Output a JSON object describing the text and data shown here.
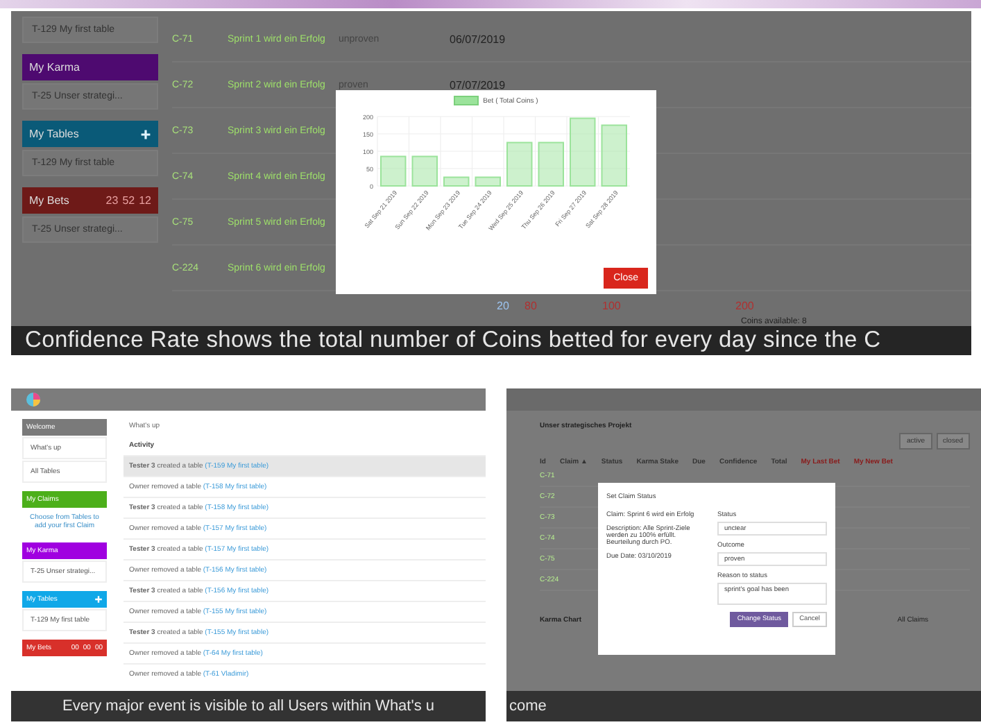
{
  "top_panel": {
    "sidebar": [
      {
        "kind": "item",
        "text": "T-129 My first table"
      },
      {
        "kind": "header",
        "text": "My Karma",
        "color": "#4e0a70"
      },
      {
        "kind": "item",
        "text": "T-25 Unser strategi..."
      },
      {
        "kind": "header-add",
        "text": "My Tables",
        "color": "#0a5a78"
      },
      {
        "kind": "item",
        "text": "T-129 My first table"
      },
      {
        "kind": "header-timer",
        "text": "My Bets",
        "color": "#6e1a18",
        "timer": [
          "23",
          "52",
          "12"
        ]
      },
      {
        "kind": "item",
        "text": "T-25 Unser strategi..."
      }
    ],
    "rows": [
      {
        "id": "C-71",
        "claim": "Sprint 1 wird ein Erfolg",
        "status": "unproven",
        "date": "06/07/2019"
      },
      {
        "id": "C-72",
        "claim": "Sprint 2 wird ein Erfolg",
        "status": "proven",
        "date": "07/07/2019"
      },
      {
        "id": "C-73",
        "claim": "Sprint 3 wird ein Erfolg"
      },
      {
        "id": "C-74",
        "claim": "Sprint 4 wird ein Erfolg"
      },
      {
        "id": "C-75",
        "claim": "Sprint 5 wird ein Erfolg"
      },
      {
        "id": "C-224",
        "claim": "Sprint 6 wird ein Erfolg"
      }
    ],
    "bet_values": [
      {
        "text": "20",
        "color": "#9cc4f0"
      },
      {
        "text": "80",
        "color": "#b03030"
      },
      {
        "text": "100",
        "color": "#b03030"
      },
      {
        "text": "200",
        "color": "#b03030"
      }
    ],
    "coins_available": "Coins available: 8",
    "modal": {
      "close_button": "Close",
      "chart_data": {
        "type": "bar",
        "categories": [
          "Sat Sep 21 2019",
          "Sun Sep 22 2019",
          "Mon Sep 23 2019",
          "Tue Sep 24 2019",
          "Wed Sep 25 2019",
          "Thu Sep 26 2019",
          "Fri Sep 27 2019",
          "Sat Sep 28 2019"
        ],
        "series": [
          {
            "name": "Bet ( Total Coins )",
            "color": "#9be39b",
            "values": [
              85,
              85,
              25,
              25,
              125,
              125,
              195,
              175
            ]
          }
        ],
        "ylim": [
          0,
          200
        ],
        "yticks": [
          0,
          50,
          100,
          150,
          200
        ],
        "grid": true
      }
    },
    "caption": "Confidence Rate shows the total number of Coins betted for every day since the C"
  },
  "bottom_left": {
    "sidebar": [
      {
        "kind": "header",
        "text": "Welcome",
        "color": "#7a7a7a"
      },
      {
        "kind": "item",
        "text": "What's up"
      },
      {
        "kind": "item",
        "text": "All Tables"
      },
      {
        "kind": "header",
        "text": "My Claims",
        "color": "#4caf1a"
      },
      {
        "kind": "note",
        "text": "Choose from Tables to add your first Claim"
      },
      {
        "kind": "header",
        "text": "My Karma",
        "color": "#a000e0"
      },
      {
        "kind": "item",
        "text": "T-25 Unser strategi..."
      },
      {
        "kind": "header-add",
        "text": "My Tables",
        "color": "#10a8e8"
      },
      {
        "kind": "item",
        "text": "T-129 My first table"
      },
      {
        "kind": "header-timer",
        "text": "My Bets",
        "color": "#d8302a",
        "timer": [
          "00",
          "00",
          "00"
        ]
      }
    ],
    "breadcrumb": "What's up",
    "activity_title": "Activity",
    "activity": [
      {
        "text": "**Tester 3** created a table",
        "link": "(T-159 My first table)",
        "selected": true
      },
      {
        "text": "Owner removed a table",
        "link": "(T-158 My first table)",
        "selected": false
      },
      {
        "text": "**Tester 3** created a table",
        "link": "(T-158 My first table)",
        "selected": false
      },
      {
        "text": "Owner removed a table",
        "link": "(T-157 My first table)",
        "selected": false
      },
      {
        "text": "**Tester 3** created a table",
        "link": "(T-157 My first table)",
        "selected": false
      },
      {
        "text": "Owner removed a table",
        "link": "(T-156 My first table)",
        "selected": false
      },
      {
        "text": "**Tester 3** created a table",
        "link": "(T-156 My first table)",
        "selected": false
      },
      {
        "text": "Owner removed a table",
        "link": "(T-155 My first table)",
        "selected": false
      },
      {
        "text": "**Tester 3** created a table",
        "link": "(T-155 My first table)",
        "selected": false
      },
      {
        "text": "Owner removed a table",
        "link": "(T-64 My first table)",
        "selected": false
      },
      {
        "text": "Owner removed a table",
        "link": "(T-61 Vladimir)",
        "selected": false
      }
    ],
    "caption": "Every major event is visible to all Users within What's u"
  },
  "bottom_right": {
    "project_title": "Unser strategisches Projekt",
    "filters": [
      {
        "label": "active",
        "selected": false
      },
      {
        "label": "closed",
        "selected": false
      }
    ],
    "columns": [
      "Id",
      "Claim ▲",
      "Status",
      "Karma Stake",
      "Due",
      "Confidence",
      "Total",
      "My Last Bet",
      "My New Bet"
    ],
    "ids": [
      "C-71",
      "C-72",
      "C-73",
      "C-74",
      "C-75",
      "C-224"
    ],
    "karma_chart": "Karma Chart",
    "all_claims": "All Claims",
    "modal": {
      "title": "Set Claim Status",
      "claim": "Claim: Sprint 6 wird ein Erfolg",
      "description": "Description: Alle Sprint-Ziele werden zu 100% erfüllt. Beurteilung durch PO.",
      "due_date": "Due Date: 03/10/2019",
      "status_label": "Status",
      "status_value": "unclear",
      "outcome_label": "Outcome",
      "outcome_value": "proven",
      "reason_label": "Reason to status",
      "reason_value": "sprint's goal has been",
      "change_button": "Change Status",
      "cancel_button": "Cancel"
    },
    "caption": "come"
  }
}
